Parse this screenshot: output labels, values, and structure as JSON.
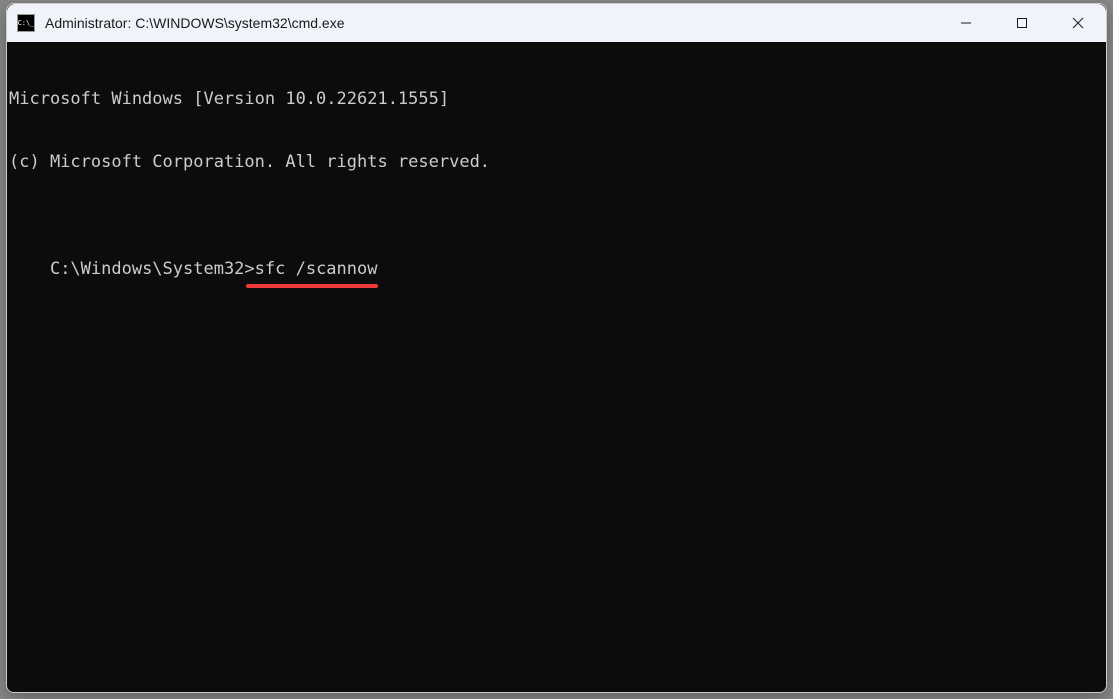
{
  "window": {
    "title": "Administrator: C:\\WINDOWS\\system32\\cmd.exe"
  },
  "terminal": {
    "line1": "Microsoft Windows [Version 10.0.22621.1555]",
    "line2": "(c) Microsoft Corporation. All rights reserved.",
    "prompt": "C:\\Windows\\System32>",
    "command": "sfc /scannow"
  },
  "annotation": {
    "underline_color": "#ed3b3b"
  }
}
